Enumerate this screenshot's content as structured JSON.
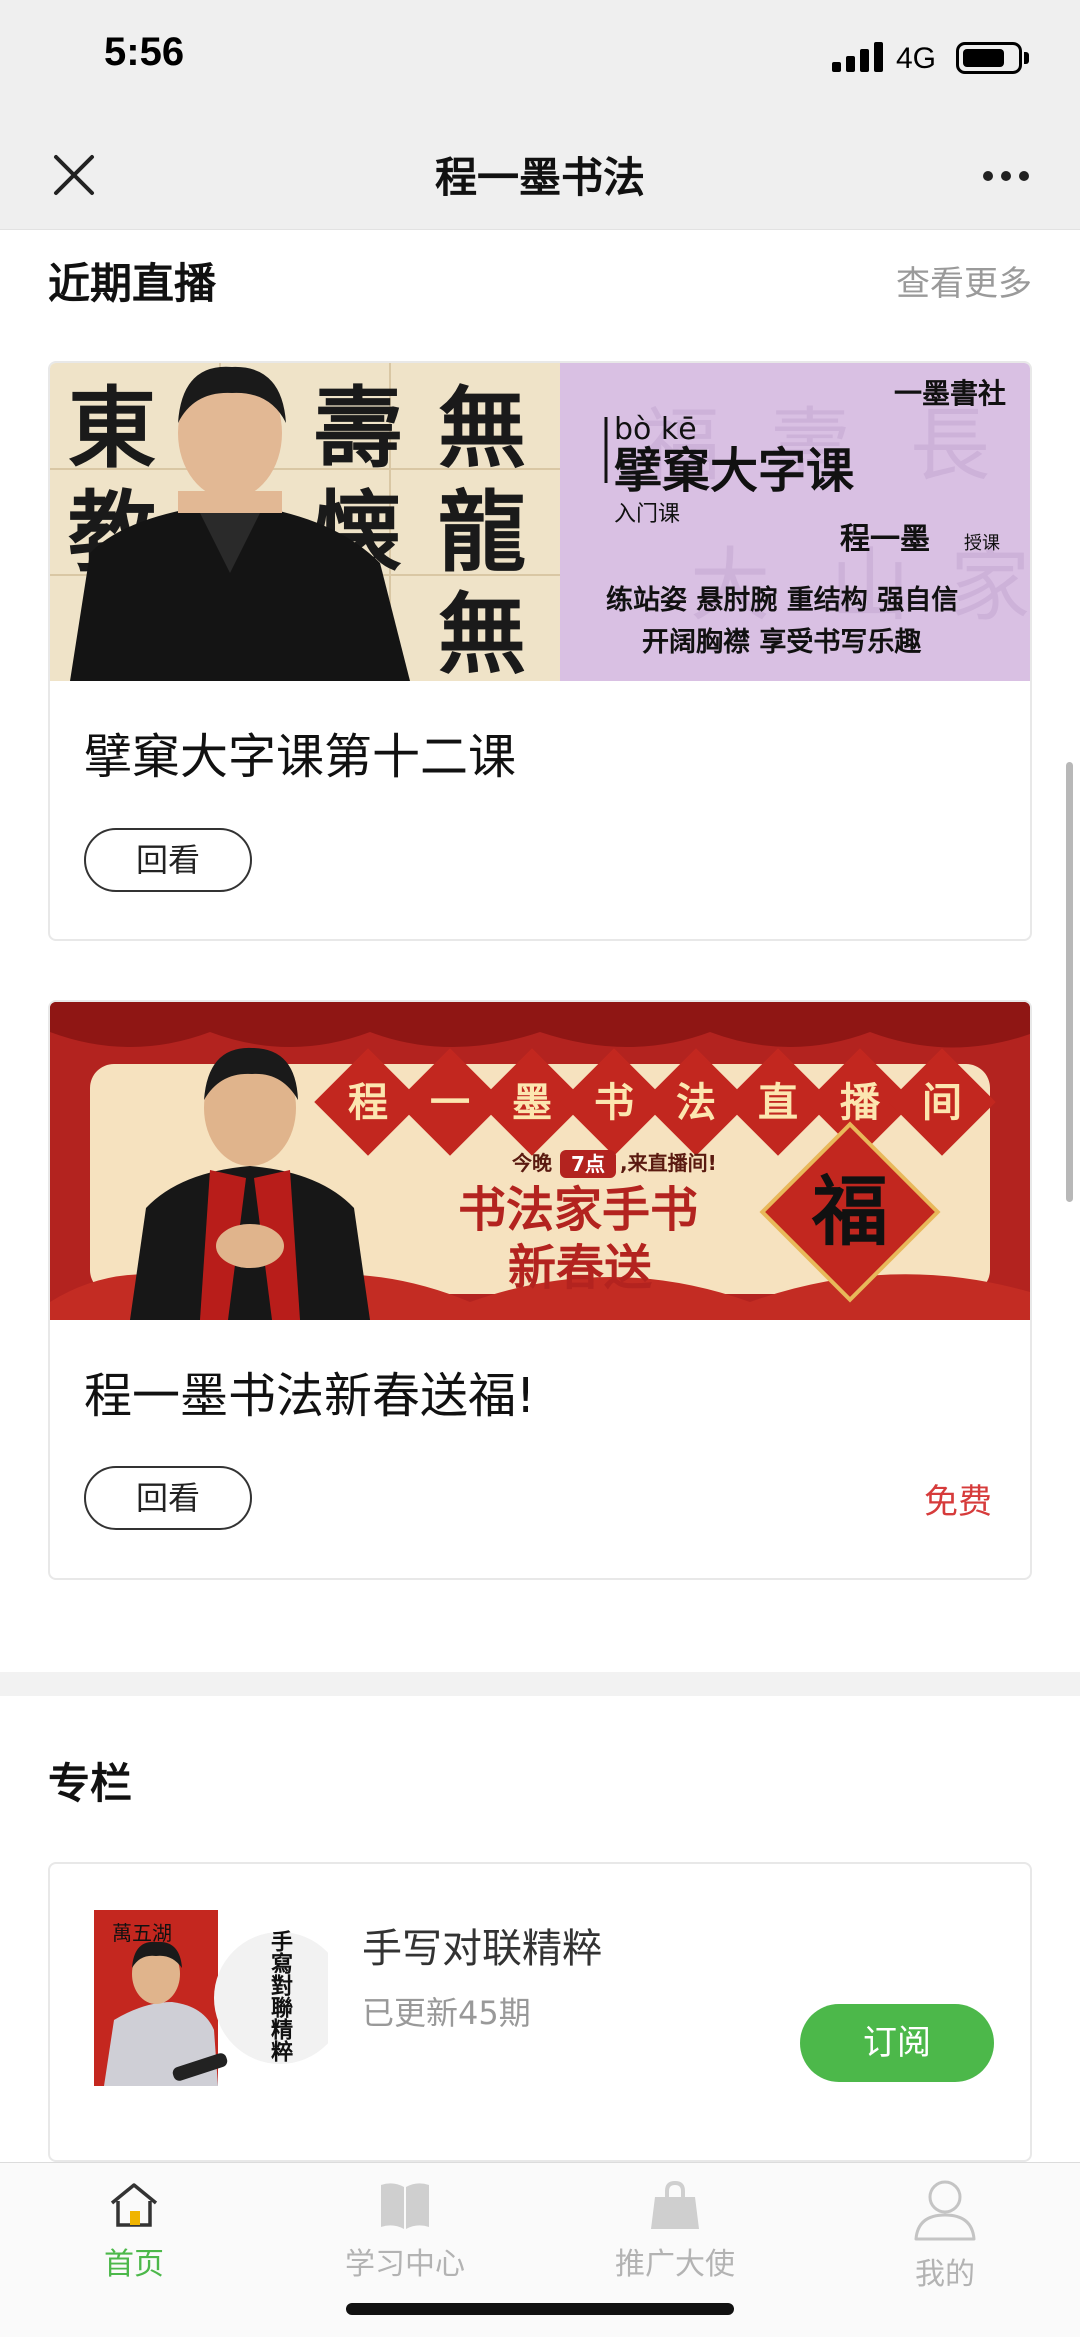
{
  "status_bar": {
    "time": "5:56",
    "network": "4G",
    "battery_level": 0.75
  },
  "nav": {
    "title": "程一墨书法"
  },
  "live_section": {
    "title": "近期直播",
    "more": "查看更多"
  },
  "live_cards": [
    {
      "title": "擘窠大字课第十二课",
      "button": "回看",
      "price": "",
      "banner": {
        "calligraphy": [
          "東",
          "壽",
          "無",
          "教",
          "懐",
          "龍",
          "無"
        ],
        "pinyin": "bò  kē",
        "course_name": "擘窠大字课",
        "course_level": "入门课",
        "publisher": "一墨書社",
        "teacher": "程一墨",
        "teacher_suffix": "授课",
        "slogan_1": "练站姿 悬肘腕 重结构 强自信",
        "slogan_2": "开阔胸襟 享受书写乐趣"
      }
    },
    {
      "title": "程一墨书法新春送福!",
      "button": "回看",
      "price": "免费",
      "banner": {
        "medallions": [
          "程",
          "一",
          "墨",
          "书",
          "法",
          "直",
          "播",
          "间"
        ],
        "tonight_prefix": "今晚",
        "tonight_time": "7点",
        "tonight_suffix": ",来直播间!",
        "headline_1": "书法家手书",
        "headline_2": "新春送",
        "fu": "福"
      }
    }
  ],
  "column_section": {
    "title": "专栏"
  },
  "column_card": {
    "title": "手写对联精粹",
    "subtitle": "已更新45期",
    "button": "订阅",
    "thumb_text": "手寫對聯精粹",
    "thumb_couplet": "萬五湖"
  },
  "tabs": [
    {
      "label": "首页",
      "icon": "home-icon",
      "active": true
    },
    {
      "label": "学习中心",
      "icon": "book-icon",
      "active": false
    },
    {
      "label": "推广大使",
      "icon": "shopping-bag-icon",
      "active": false
    },
    {
      "label": "我的",
      "icon": "person-icon",
      "active": false
    }
  ],
  "colors": {
    "accent_green": "#4cb84a",
    "price_red": "#d63b3b",
    "banner_purple": "#d9c0e3",
    "banner_red": "#b3231f"
  }
}
